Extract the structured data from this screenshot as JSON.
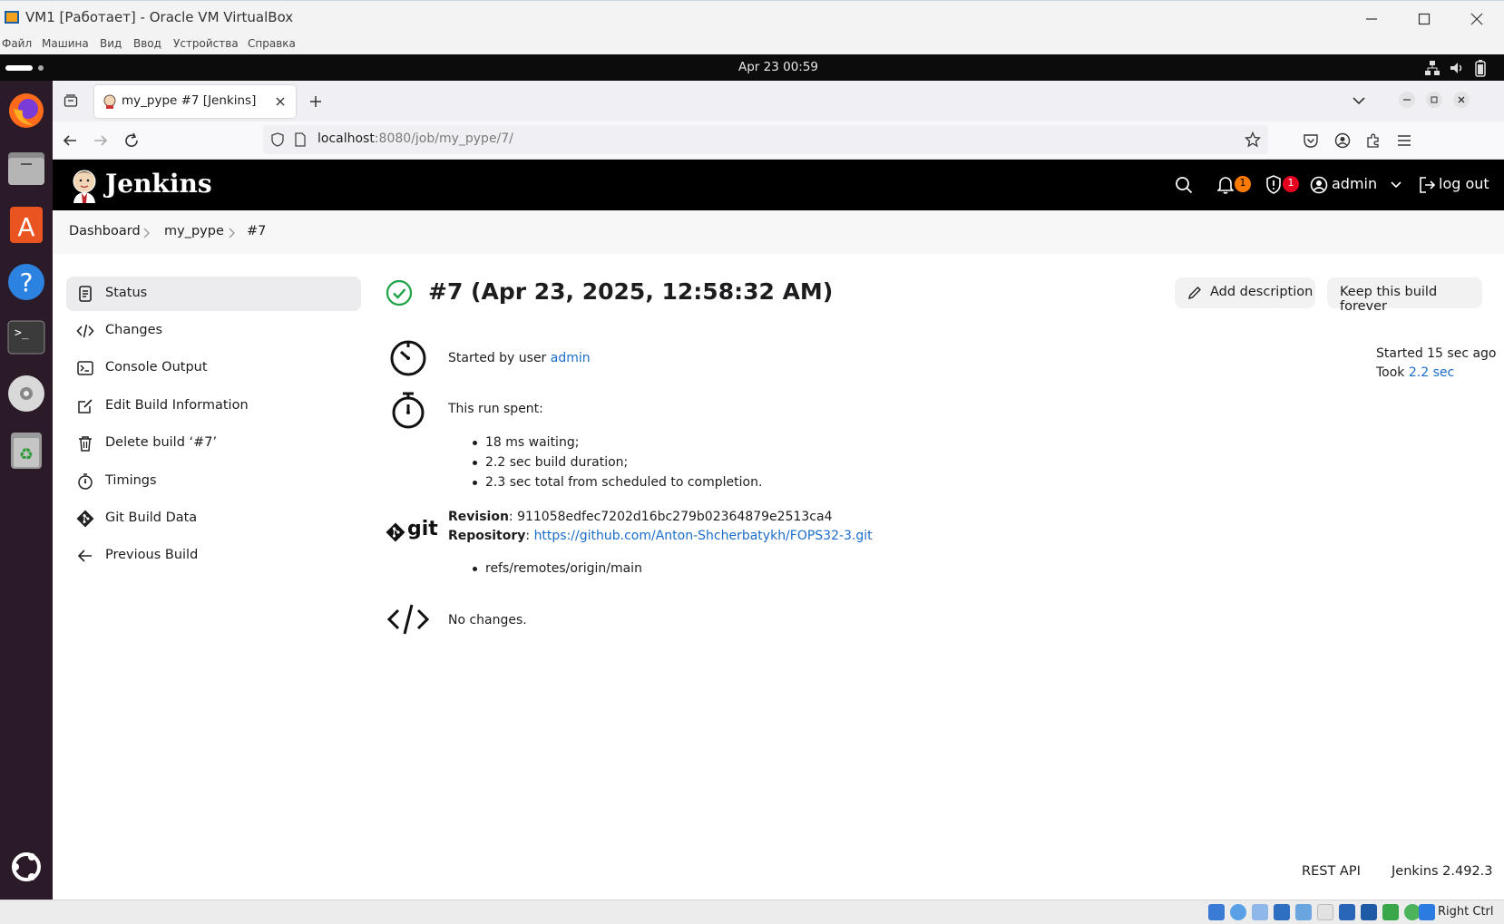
{
  "vbox": {
    "title": "VM1 [Работает] - Oracle VM VirtualBox",
    "menu": [
      "Файл",
      "Машина",
      "Вид",
      "Ввод",
      "Устройства",
      "Справка"
    ],
    "host_key": "Right Ctrl"
  },
  "gnome": {
    "clock": "Apr 23  00:59"
  },
  "browser": {
    "tab_title": "my_pype #7 [Jenkins]",
    "url_host": "localhost",
    "url_rest": ":8080/job/my_pype/7/"
  },
  "jenkins": {
    "brand": "Jenkins",
    "notifications_count": "1",
    "security_count": "1",
    "user": "admin",
    "logout": "log out",
    "breadcrumb": [
      "Dashboard",
      "my_pype",
      "#7"
    ],
    "sidebar": [
      {
        "label": "Status",
        "icon": "document-icon"
      },
      {
        "label": "Changes",
        "icon": "code-icon"
      },
      {
        "label": "Console Output",
        "icon": "terminal-icon"
      },
      {
        "label": "Edit Build Information",
        "icon": "edit-icon"
      },
      {
        "label": "Delete build ‘#7’",
        "icon": "trash-icon"
      },
      {
        "label": "Timings",
        "icon": "stopwatch-icon"
      },
      {
        "label": "Git Build Data",
        "icon": "git-icon"
      },
      {
        "label": "Previous Build",
        "icon": "arrow-left-icon"
      }
    ],
    "build_title": "#7 (Apr 23, 2025, 12:58:32 AM)",
    "add_description": "Add description",
    "keep_forever": "Keep this build forever",
    "started_by_prefix": "Started by user ",
    "started_by_user": "admin",
    "started_ago": "Started 15 sec ago",
    "took_prefix": "Took ",
    "took_value": "2.2 sec",
    "run_spent": "This run spent:",
    "timings": [
      "18 ms waiting;",
      "2.2 sec build duration;",
      "2.3 sec total from scheduled to completion."
    ],
    "revision_label": "Revision",
    "revision_value": ": 911058edfec7202d16bc279b02364879e2513ca4",
    "repository_label": "Repository",
    "repository_sep": ": ",
    "repository_url": "https://github.com/Anton-Shcherbatykh/FOPS32-3.git",
    "refs": [
      "refs/remotes/origin/main"
    ],
    "no_changes": "No changes.",
    "git_logo_text": "git",
    "footer_rest_api": "REST API",
    "footer_version": "Jenkins 2.492.3"
  },
  "colors": {
    "success": "#1ea446",
    "link": "#1b6cc9",
    "badge": "#ff7a00",
    "badge_red": "#e6001f"
  }
}
